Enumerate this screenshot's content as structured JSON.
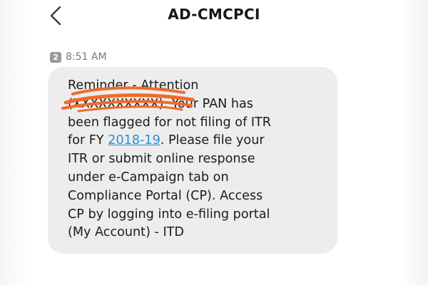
{
  "header": {
    "title": "AD-CMCPCI",
    "back_icon": "chevron-left-icon"
  },
  "message": {
    "sim_slot": "2",
    "time": "8:51 AM",
    "lines": {
      "l1": "Reminder - Attention",
      "l2_masked": "(XXXXXXXXXX)",
      "l2_rest": ". Your PAN has",
      "l3": "been flagged for not filing of ITR",
      "l4_pre": "for FY ",
      "l4_link": "2018-19",
      "l4_post": ". Please file your",
      "l5": "ITR or submit online response",
      "l6": "under e-Campaign tab on",
      "l7": "Compliance Portal (CP). Access",
      "l8": "CP by logging into e-filing portal",
      "l9": "(My Account) - ITD"
    },
    "redaction_color": "#f26a2a",
    "link_color": "#2b8fd6",
    "bubble_color": "#ededed"
  }
}
